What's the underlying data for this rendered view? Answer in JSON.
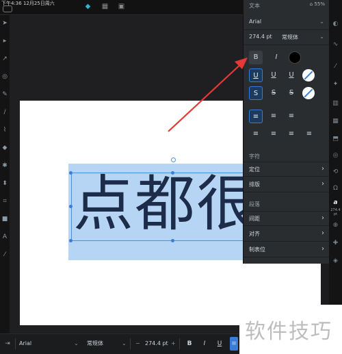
{
  "status_bar": {
    "time": "下午4:36  12月25日周六"
  },
  "canvas": {
    "text": "点都很"
  },
  "panel": {
    "title": "文本",
    "status": "⌂ 55%",
    "font_name": "Arial",
    "font_size": "274.4 pt",
    "font_style": "常规体",
    "bold": "B",
    "italic": "I",
    "underline_labels": [
      "U",
      "U",
      "U"
    ],
    "strike_labels": [
      "S",
      "S",
      "S"
    ],
    "sections": {
      "character": "字符",
      "paragraph": "段落"
    },
    "character_items": [
      "定位",
      "排版"
    ],
    "paragraph_items": [
      "间距",
      "对齐",
      "制表位"
    ]
  },
  "right_strip": {
    "font_size_label": "274.4 pt",
    "font_icon": "a"
  },
  "bottom_bar": {
    "font_name": "Arial",
    "font_style": "常规体",
    "minus": "−",
    "size": "274.4 pt",
    "plus": "+",
    "bold": "B",
    "italic": "I",
    "underline": "U"
  },
  "watermark": "软件技巧",
  "colors": {
    "accent": "#3a7bd5",
    "arrow": "#e53935",
    "selection": "#b6d5f5",
    "text": "#1d2c48"
  }
}
